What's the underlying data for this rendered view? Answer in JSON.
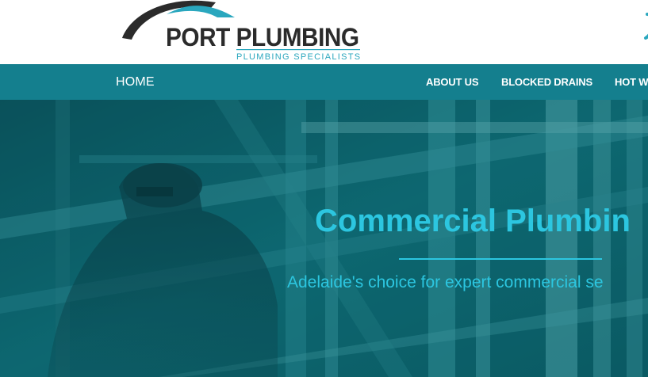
{
  "header": {
    "logo": {
      "name": "PORT PLUMBING",
      "tagline": "PLUMBING SPECIALISTS"
    },
    "phone_icon": "phone-icon"
  },
  "nav": {
    "home": "HOME",
    "items": [
      {
        "label": "ABOUT US"
      },
      {
        "label": "BLOCKED DRAINS"
      },
      {
        "label": "HOT W"
      }
    ]
  },
  "hero": {
    "title": "Commercial Plumbin",
    "subtitle": "Adelaide's choice for expert commercial se",
    "background": "industrial-plumber-photo"
  },
  "colors": {
    "brand_teal": "#147f8e",
    "accent_cyan": "#2cc6e0",
    "logo_text": "#2b2b2b",
    "hero_overlay": "#0b5e66"
  }
}
